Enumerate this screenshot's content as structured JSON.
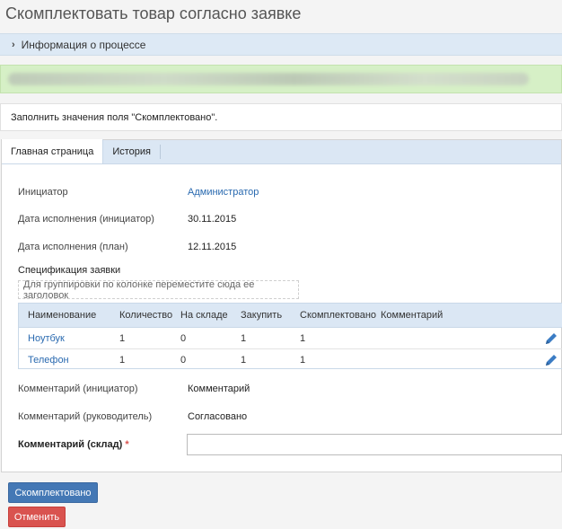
{
  "page": {
    "title": "Скомплектовать товар согласно заявке"
  },
  "process_info": {
    "label": "Информация о процессе",
    "icon": "chevron-right-icon"
  },
  "notice": {
    "text": "Заполнить значения поля \"Скомплектовано\"."
  },
  "tabs": [
    {
      "label": "Главная страница",
      "active": true
    },
    {
      "label": "История",
      "active": false
    }
  ],
  "fields": {
    "initiator": {
      "label": "Инициатор",
      "value": "Администратор"
    },
    "due_initiator": {
      "label": "Дата исполнения (инициатор)",
      "value": "30.11.2015"
    },
    "due_plan": {
      "label": "Дата исполнения (план)",
      "value": "12.11.2015"
    },
    "comment_initiator": {
      "label": "Комментарий (инициатор)",
      "value": "Комментарий"
    },
    "comment_manager": {
      "label": "Комментарий (руководитель)",
      "value": "Согласовано"
    },
    "comment_warehouse": {
      "label": "Комментарий (склад)",
      "required_mark": "*",
      "value": ""
    }
  },
  "spec": {
    "title": "Спецификация заявки",
    "group_hint": "Для группировки по колонке переместите сюда ее заголовок",
    "columns": [
      "Наименование",
      "Количество",
      "На складе",
      "Закупить",
      "Скомплектовано",
      "Комментарий"
    ],
    "rows": [
      {
        "name": "Ноутбук",
        "qty": "1",
        "stock": "0",
        "buy": "1",
        "done": "1",
        "comment": ""
      },
      {
        "name": "Телефон",
        "qty": "1",
        "stock": "0",
        "buy": "1",
        "done": "1",
        "comment": ""
      }
    ],
    "edit_icon": "pencil-icon"
  },
  "buttons": {
    "complete": "Скомплектовано",
    "cancel": "Отменить"
  },
  "colors": {
    "primary": "#4478b5",
    "danger": "#d9534f",
    "link": "#2a6ab0",
    "header_bg": "#dbe7f4",
    "success_bg": "#d6f0c6"
  }
}
